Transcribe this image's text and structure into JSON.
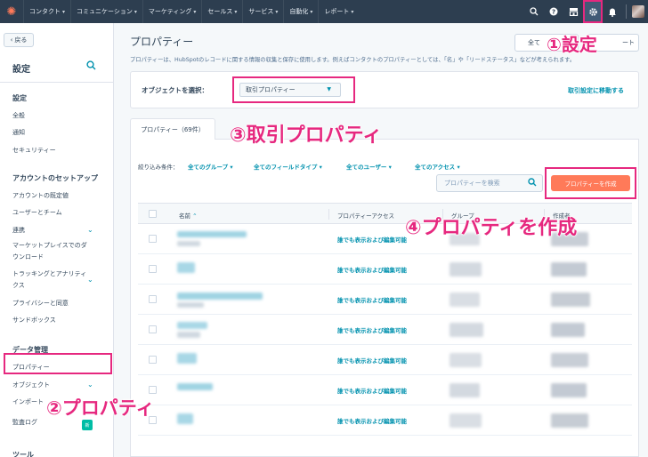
{
  "topnav": {
    "logo": "hubspot-sprocket-icon",
    "items": [
      {
        "label": "コンタクト"
      },
      {
        "label": "コミュニケーション"
      },
      {
        "label": "マーケティング"
      },
      {
        "label": "セールス"
      },
      {
        "label": "サービス"
      },
      {
        "label": "自動化"
      },
      {
        "label": "レポート"
      }
    ],
    "icons": [
      "search-icon",
      "help-icon",
      "marketplace-icon",
      "gear-icon",
      "bell-icon"
    ]
  },
  "sidebar": {
    "back_label": "戻る",
    "title": "設定",
    "sections": [
      {
        "title": "設定",
        "items": [
          "全般",
          "通知",
          "セキュリティー"
        ]
      },
      {
        "title": "アカウントのセットアップ",
        "items": [
          "アカウントの既定値",
          "ユーザーとチーム",
          "連携",
          "マーケットプレイスでのダウンロード",
          "トラッキングとアナリティクス",
          "プライバシーと同意",
          "サンドボックス"
        ]
      },
      {
        "title": "データ管理",
        "items": [
          "プロパティー",
          "オブジェクト",
          "インポート",
          "監査ログ"
        ]
      },
      {
        "title": "ツール",
        "items": []
      }
    ],
    "badge": "新"
  },
  "main": {
    "title": "プロパティー",
    "top_button_1": "全て",
    "top_button_2": "ート",
    "description": "プロパティーは、HubSpotのレコードに関する情報の収集と保存に使用します。例えばコンタクトのプロパティーとしては、「名」や「リードステータス」などが考えられます。",
    "object_label": "オブジェクトを選択：",
    "object_value": "取引プロパティー",
    "object_link": "取引設定に移動する",
    "tab": "プロパティー（69件）",
    "filter_label": "絞り込み条件：",
    "filters": [
      "全てのグループ",
      "全てのフィールドタイプ",
      "全てのユーザー",
      "全てのアクセス"
    ],
    "search_placeholder": "プロパティーを検索",
    "create_button": "プロパティーを作成",
    "columns": [
      "名前",
      "プロパティーアクセス",
      "グループ",
      "作成者"
    ],
    "rows": [
      {
        "access": "誰でも表示および編集可能"
      },
      {
        "access": "誰でも表示および編集可能"
      },
      {
        "access": "誰でも表示および編集可能"
      },
      {
        "access": "誰でも表示および編集可能"
      },
      {
        "access": "誰でも表示および編集可能"
      },
      {
        "access": "誰でも表示および編集可能"
      },
      {
        "access": "誰でも表示および編集可能"
      }
    ]
  },
  "annotations": {
    "a1": "①設定",
    "a2": "②プロパティ",
    "a3": "③取引プロパティ",
    "a4": "④プロパティを作成"
  },
  "colors": {
    "nav_bg": "#2d3e50",
    "accent_link": "#0091ae",
    "primary_button": "#ff7a59",
    "annotation": "#e6287f"
  }
}
